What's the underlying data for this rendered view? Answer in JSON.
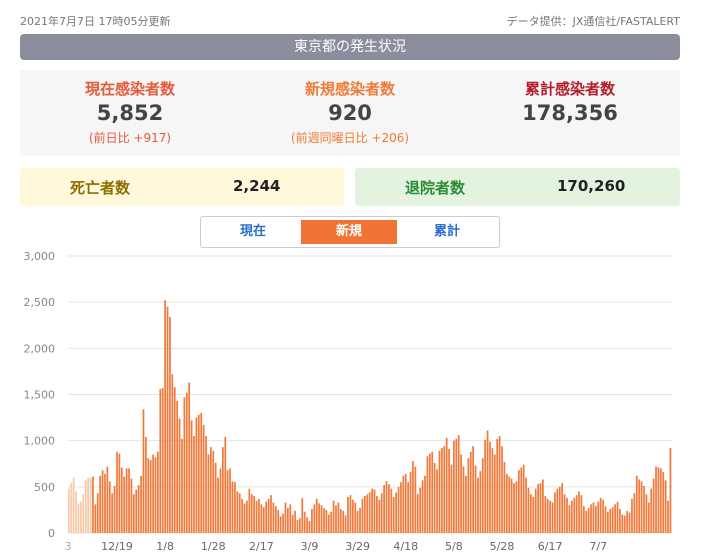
{
  "header": {
    "updated": "2021年7月7日 17時05分更新",
    "source": "データ提供：JX通信社/FASTALERT",
    "title": "東京都の発生状況"
  },
  "stats": {
    "current": {
      "label": "現在感染者数",
      "value": "5,852",
      "sub": "(前日比 +917)"
    },
    "new": {
      "label": "新規感染者数",
      "value": "920",
      "sub": "(前週同曜日比 +206)"
    },
    "total": {
      "label": "累計感染者数",
      "value": "178,356"
    }
  },
  "death": {
    "label": "死亡者数",
    "value": "2,244"
  },
  "recovered": {
    "label": "退院者数",
    "value": "170,260"
  },
  "tabs": [
    "現在",
    "新規",
    "累計"
  ],
  "active_tab": 1,
  "colors": {
    "bar": "#f07a3c",
    "fade_bar": "#f8c9a8",
    "grid": "#e4e4e4"
  },
  "chart_data": {
    "type": "bar",
    "ylim": [
      0,
      3000
    ],
    "yticks": [
      "0",
      "500",
      "1,000",
      "1,500",
      "2,000",
      "2,500",
      "3,000"
    ],
    "xtick_labels": [
      "12/19",
      "1/8",
      "1/28",
      "2/17",
      "3/9",
      "3/29",
      "4/18",
      "5/8",
      "5/28",
      "6/17",
      "7/7"
    ],
    "xtick_index": [
      20,
      40,
      60,
      80,
      100,
      120,
      140,
      160,
      180,
      200,
      220
    ],
    "left_edge_label": "3",
    "fade_count": 10,
    "values": [
      480,
      540,
      600,
      450,
      320,
      340,
      420,
      570,
      600,
      600,
      610,
      310,
      430,
      620,
      680,
      640,
      720,
      560,
      430,
      510,
      880,
      860,
      710,
      610,
      700,
      700,
      590,
      420,
      470,
      520,
      620,
      1340,
      1040,
      810,
      790,
      850,
      820,
      880,
      1560,
      1570,
      2520,
      2450,
      2340,
      1720,
      1580,
      1430,
      1240,
      1020,
      1470,
      1520,
      1630,
      1220,
      1050,
      1250,
      1280,
      1300,
      1170,
      1050,
      850,
      930,
      890,
      760,
      600,
      700,
      930,
      1040,
      680,
      700,
      560,
      550,
      450,
      430,
      370,
      320,
      350,
      480,
      420,
      400,
      350,
      370,
      310,
      280,
      340,
      370,
      410,
      330,
      290,
      250,
      180,
      210,
      330,
      270,
      310,
      200,
      240,
      140,
      160,
      380,
      230,
      170,
      130,
      260,
      310,
      370,
      320,
      300,
      270,
      250,
      200,
      230,
      350,
      300,
      330,
      260,
      240,
      190,
      390,
      410,
      360,
      330,
      240,
      270,
      370,
      400,
      420,
      440,
      480,
      470,
      400,
      360,
      430,
      520,
      560,
      530,
      480,
      390,
      440,
      500,
      550,
      620,
      640,
      550,
      660,
      780,
      720,
      420,
      490,
      570,
      620,
      830,
      860,
      880,
      760,
      690,
      890,
      920,
      940,
      1030,
      910,
      740,
      1000,
      1020,
      1060,
      850,
      720,
      620,
      810,
      880,
      940,
      730,
      600,
      670,
      810,
      1010,
      1110,
      990,
      920,
      850,
      1020,
      1050,
      940,
      770,
      640,
      610,
      590,
      540,
      560,
      680,
      710,
      740,
      600,
      490,
      420,
      390,
      480,
      530,
      540,
      580,
      400,
      370,
      350,
      330,
      440,
      480,
      500,
      540,
      420,
      380,
      300,
      350,
      380,
      410,
      450,
      410,
      290,
      240,
      270,
      310,
      330,
      290,
      340,
      380,
      360,
      290,
      230,
      260,
      280,
      310,
      340,
      260,
      200,
      190,
      240,
      220,
      370,
      430,
      620,
      580,
      560,
      510,
      420,
      330,
      480,
      590,
      720,
      710,
      700,
      660,
      570,
      350,
      920
    ]
  }
}
